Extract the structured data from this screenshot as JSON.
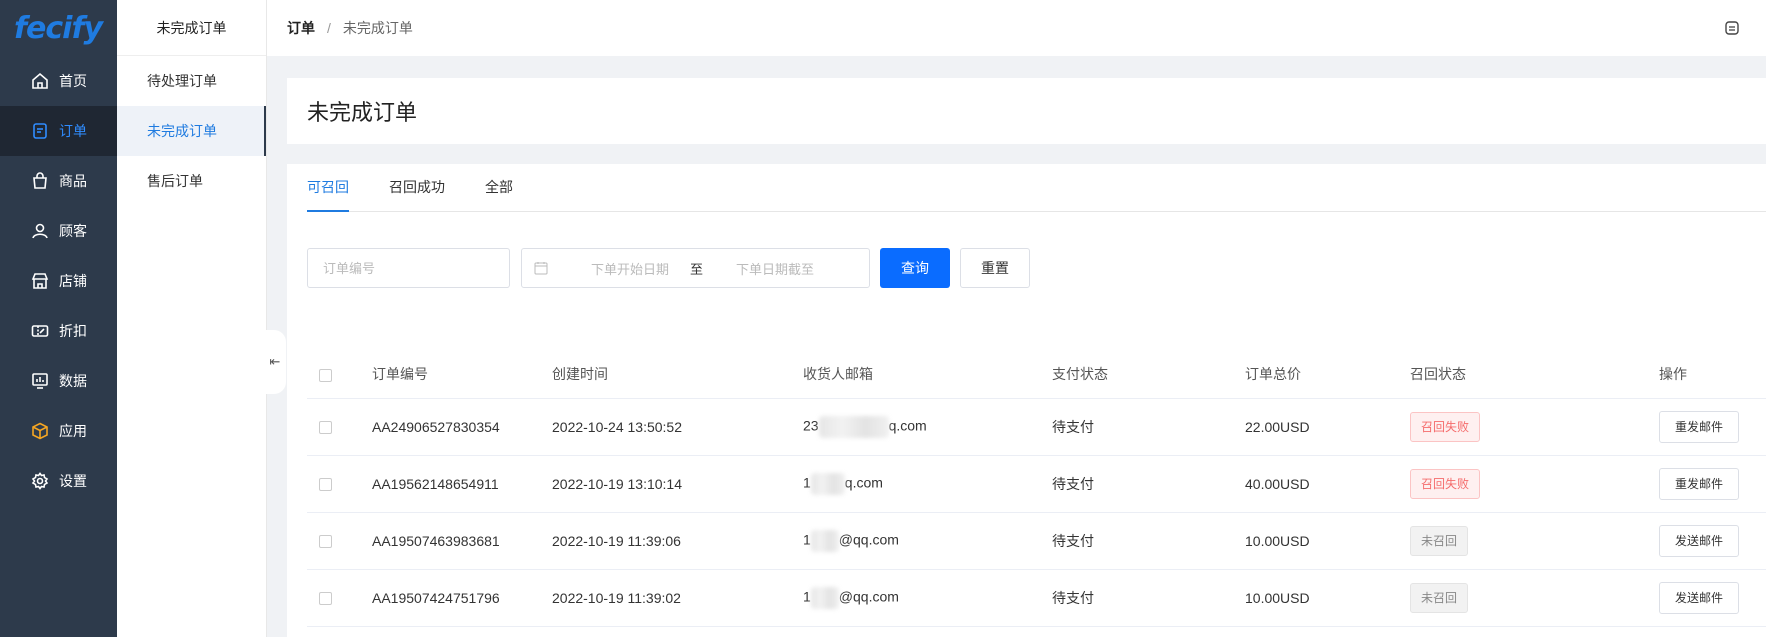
{
  "app": {
    "logo": "fecify"
  },
  "sidebar": {
    "items": [
      {
        "label": "首页",
        "icon": "home-icon"
      },
      {
        "label": "订单",
        "icon": "order-icon",
        "active": true
      },
      {
        "label": "商品",
        "icon": "bag-icon"
      },
      {
        "label": "顾客",
        "icon": "user-icon"
      },
      {
        "label": "店铺",
        "icon": "store-icon"
      },
      {
        "label": "折扣",
        "icon": "ticket-icon"
      },
      {
        "label": "数据",
        "icon": "chart-icon"
      },
      {
        "label": "应用",
        "icon": "cube-icon"
      },
      {
        "label": "设置",
        "icon": "gear-icon"
      }
    ]
  },
  "submenu": {
    "title": "未完成订单",
    "items": [
      {
        "label": "待处理订单"
      },
      {
        "label": "未完成订单",
        "active": true
      },
      {
        "label": "售后订单"
      }
    ]
  },
  "header": {
    "breadcrumb": [
      "订单",
      "未完成订单"
    ],
    "separator": "/"
  },
  "page": {
    "title": "未完成订单"
  },
  "tabs": [
    {
      "label": "可召回",
      "active": true
    },
    {
      "label": "召回成功"
    },
    {
      "label": "全部"
    }
  ],
  "filters": {
    "order_no_placeholder": "订单编号",
    "start_placeholder": "下单开始日期",
    "range_separator": "至",
    "end_placeholder": "下单日期截至",
    "search_label": "查询",
    "reset_label": "重置"
  },
  "table": {
    "columns": [
      "订单编号",
      "创建时间",
      "收货人邮箱",
      "支付状态",
      "订单总价",
      "召回状态",
      "操作"
    ],
    "rows": [
      {
        "order_no": "AA24906527830354",
        "created": "2022-10-24 13:50:52",
        "email_prefix": "23",
        "email_suffix": "q.com",
        "pay_status": "待支付",
        "total": "22.00USD",
        "recall": "召回失败",
        "recall_type": "fail",
        "action": "重发邮件"
      },
      {
        "order_no": "AA19562148654911",
        "created": "2022-10-19 13:10:14",
        "email_prefix": "1",
        "email_suffix": "q.com",
        "pay_status": "待支付",
        "total": "40.00USD",
        "recall": "召回失败",
        "recall_type": "fail",
        "action": "重发邮件"
      },
      {
        "order_no": "AA19507463983681",
        "created": "2022-10-19 11:39:06",
        "email_prefix": "1",
        "email_suffix": "@qq.com",
        "pay_status": "待支付",
        "total": "10.00USD",
        "recall": "未召回",
        "recall_type": "none",
        "action": "发送邮件"
      },
      {
        "order_no": "AA19507424751796",
        "created": "2022-10-19 11:39:02",
        "email_prefix": "1",
        "email_suffix": "@qq.com",
        "pay_status": "待支付",
        "total": "10.00USD",
        "recall": "未召回",
        "recall_type": "none",
        "action": "发送邮件"
      }
    ]
  },
  "colors": {
    "primary": "#0a6cff",
    "sidebar_bg": "#2d3a4b",
    "active_text": "#1f7be0",
    "fail_text": "#f56c6c"
  }
}
